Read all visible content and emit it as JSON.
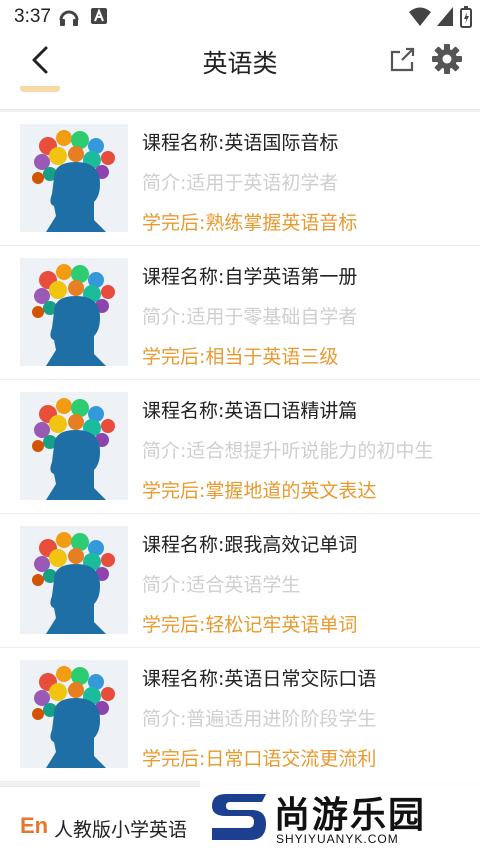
{
  "status": {
    "time": "3:37"
  },
  "appbar": {
    "title": "英语类"
  },
  "courses": [
    {
      "name": "课程名称:英语国际音标",
      "intro": "简介:适用于英语初学者",
      "after": "学完后:熟练掌握英语音标"
    },
    {
      "name": "课程名称:自学英语第一册",
      "intro": "简介:适用于零基础自学者",
      "after": "学完后:相当于英语三级"
    },
    {
      "name": "课程名称:英语口语精讲篇",
      "intro": "简介:适合想提升听说能力的初中生",
      "after": "学完后:掌握地道的英文表达"
    },
    {
      "name": "课程名称:跟我高效记单词",
      "intro": "简介:适合英语学生",
      "after": "学完后:轻松记牢英语单词"
    },
    {
      "name": "课程名称:英语日常交际口语",
      "intro": "简介:普遍适用进阶阶段学生",
      "after": "学完后:日常口语交流更流利"
    }
  ],
  "bottom": {
    "badge": "En",
    "title": "人教版小学英语"
  },
  "watermark": {
    "brand": "尚游乐园",
    "url": "SHYIYUANYK.COM"
  },
  "colors": {
    "accent": "#e89a2f",
    "muted": "#cfcfcf"
  }
}
